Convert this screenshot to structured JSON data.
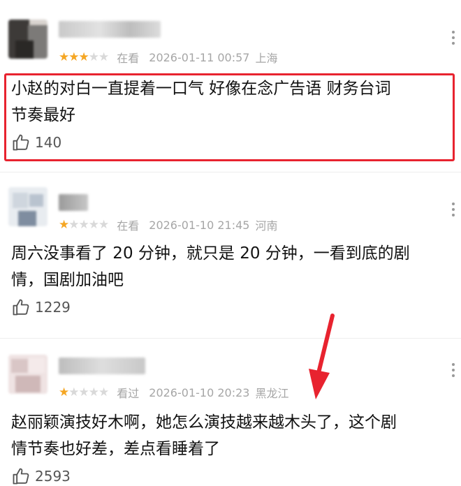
{
  "comments": [
    {
      "stars": 3,
      "status": "在看",
      "date": "2026-01-11 00:57",
      "location": "上海",
      "text_lines": [
        "小赵的对白一直提着一口气 好像在念广告语 财务台词",
        "节奏最好"
      ],
      "likes": "140"
    },
    {
      "stars": 1,
      "status": "在看",
      "date": "2026-01-10 21:45",
      "location": "河南",
      "text_lines": [
        "周六没事看了 20 分钟，就只是 20 分钟，一看到底的剧",
        "情，国剧加油吧"
      ],
      "likes": "1229"
    },
    {
      "stars": 1,
      "status": "看过",
      "date": "2026-01-10 20:23",
      "location": "黑龙江",
      "text_lines": [
        "赵丽颖演技好木啊，她怎么演技越来越木头了，这个剧",
        "情节奏也好差，差点看睡着了"
      ],
      "likes": "2593"
    }
  ],
  "icons": {
    "star": "star-icon",
    "like": "thumbs-up-icon",
    "more": "more-dots-icon",
    "annotation_arrow": "red-arrow-icon"
  },
  "colors": {
    "star_on": "#f5a623",
    "star_off": "#d9d9d9",
    "highlight_border": "#e8232f",
    "arrow": "#e8232f",
    "meta_text": "#a6a6a6"
  }
}
